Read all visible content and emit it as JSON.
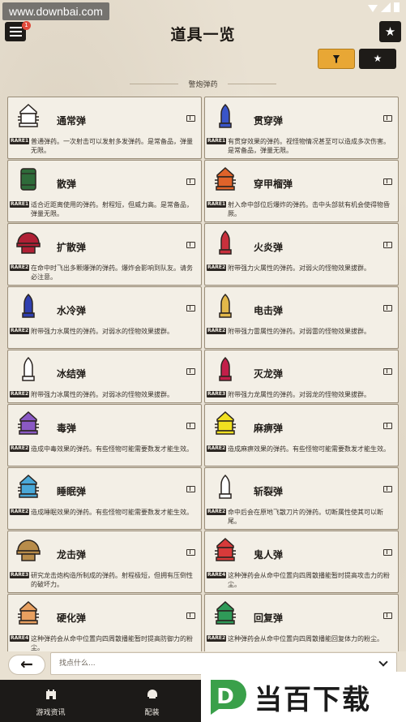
{
  "watermark": "www.downbai.com",
  "header": {
    "title": "道具一览",
    "menu_badge": "1"
  },
  "section_title": "警炮弹药",
  "items": [
    {
      "name": "通常弹",
      "rare": "RARE1",
      "desc": "普通弹药。一次射击可以发射多发弹药。是常备品，弹量无限。",
      "color": "#ffffff",
      "shape": "shell",
      "accent": "#2b2b2b"
    },
    {
      "name": "贯穿弹",
      "rare": "RARE1",
      "desc": "有贯穿效果的弹药。视怪物情况甚至可以造成多次伤害。是常备品，弹量无限。",
      "color": "#3a55c8",
      "shape": "bullet"
    },
    {
      "name": "散弹",
      "rare": "RARE1",
      "desc": "适合近距离使用的弹药。射程短，但威力高。是常备品，弹量无限。",
      "color": "#2f6b3a",
      "shape": "can"
    },
    {
      "name": "穿甲榴弹",
      "rare": "RARE1",
      "desc": "射入命中部位后爆炸的弹药。击中头部就有机会使得物昏厥。",
      "color": "#e0632a",
      "shape": "shell"
    },
    {
      "name": "扩散弹",
      "rare": "RARE2",
      "desc": "在命中时飞出多颗爆弹的弹药。爆炸会影响到队友。请务必注意。",
      "color": "#b02035",
      "shape": "dome"
    },
    {
      "name": "火炎弹",
      "rare": "RARE2",
      "desc": "附带强力火属性的弹药。对弱火的怪物效果拔群。",
      "color": "#c8303c",
      "shape": "bullet"
    },
    {
      "name": "水冷弹",
      "rare": "RARE2",
      "desc": "附带强力水属性的弹药。对弱水的怪物效果拔群。",
      "color": "#2f3fb0",
      "shape": "bullet"
    },
    {
      "name": "电击弹",
      "rare": "RARE2",
      "desc": "附带强力雷属性的弹药。对弱雷的怪物效果拔群。",
      "color": "#e3b84a",
      "shape": "bullet"
    },
    {
      "name": "冰结弹",
      "rare": "RARE2",
      "desc": "附带强力冰属性的弹药。对弱冰的怪物效果拔群。",
      "color": "#ffffff",
      "shape": "bullet"
    },
    {
      "name": "灭龙弹",
      "rare": "RARE3",
      "desc": "附带强力龙属性的弹药。对弱龙的怪物效果拔群。",
      "color": "#c21f4a",
      "shape": "bullet"
    },
    {
      "name": "毒弹",
      "rare": "RARE2",
      "desc": "造成中毒效果的弹药。有些怪物可能需要数发才能生效。",
      "color": "#8a59c4",
      "shape": "shell"
    },
    {
      "name": "麻痹弹",
      "rare": "RARE2",
      "desc": "造成麻痹效果的弹药。有些怪物可能需要数发才能生效。",
      "color": "#f0e020",
      "shape": "shell"
    },
    {
      "name": "睡眠弹",
      "rare": "RARE2",
      "desc": "造成睡眠效果的弹药。有些怪物可能需要数发才能生效。",
      "color": "#4aa8d8",
      "shape": "shell"
    },
    {
      "name": "斩裂弹",
      "rare": "RARE2",
      "desc": "命中后会在原地飞散刀片的弹药。切断属性使其可以断尾。",
      "color": "#ffffff",
      "shape": "bullet"
    },
    {
      "name": "龙击弹",
      "rare": "RARE3",
      "desc": "研究龙击炮构造所制成的弹药。射程极短，但拥有压倒性的破坏力。",
      "color": "#b88c4a",
      "shape": "dome"
    },
    {
      "name": "鬼人弹",
      "rare": "RARE4",
      "desc": "这种弹药会从命中位置向四周散播能暂时提高攻击力的粉尘。",
      "color": "#d83a3a",
      "shape": "shell"
    },
    {
      "name": "硬化弹",
      "rare": "RARE4",
      "desc": "这种弹药会从命中位置向四周散播能暂时提高防御力的粉尘。",
      "color": "#e8a060",
      "shape": "shell"
    },
    {
      "name": "回复弹",
      "rare": "RARE2",
      "desc": "这种弹药会从命中位置向四周散播能回复体力的粉尘。",
      "color": "#2f9a58",
      "shape": "shell"
    }
  ],
  "search": {
    "placeholder": "找点什么..."
  },
  "bottom_nav": [
    {
      "label": "游戏资讯"
    },
    {
      "label": "配装"
    }
  ],
  "brand": {
    "logo_letter": "D",
    "text": "当百下载"
  }
}
